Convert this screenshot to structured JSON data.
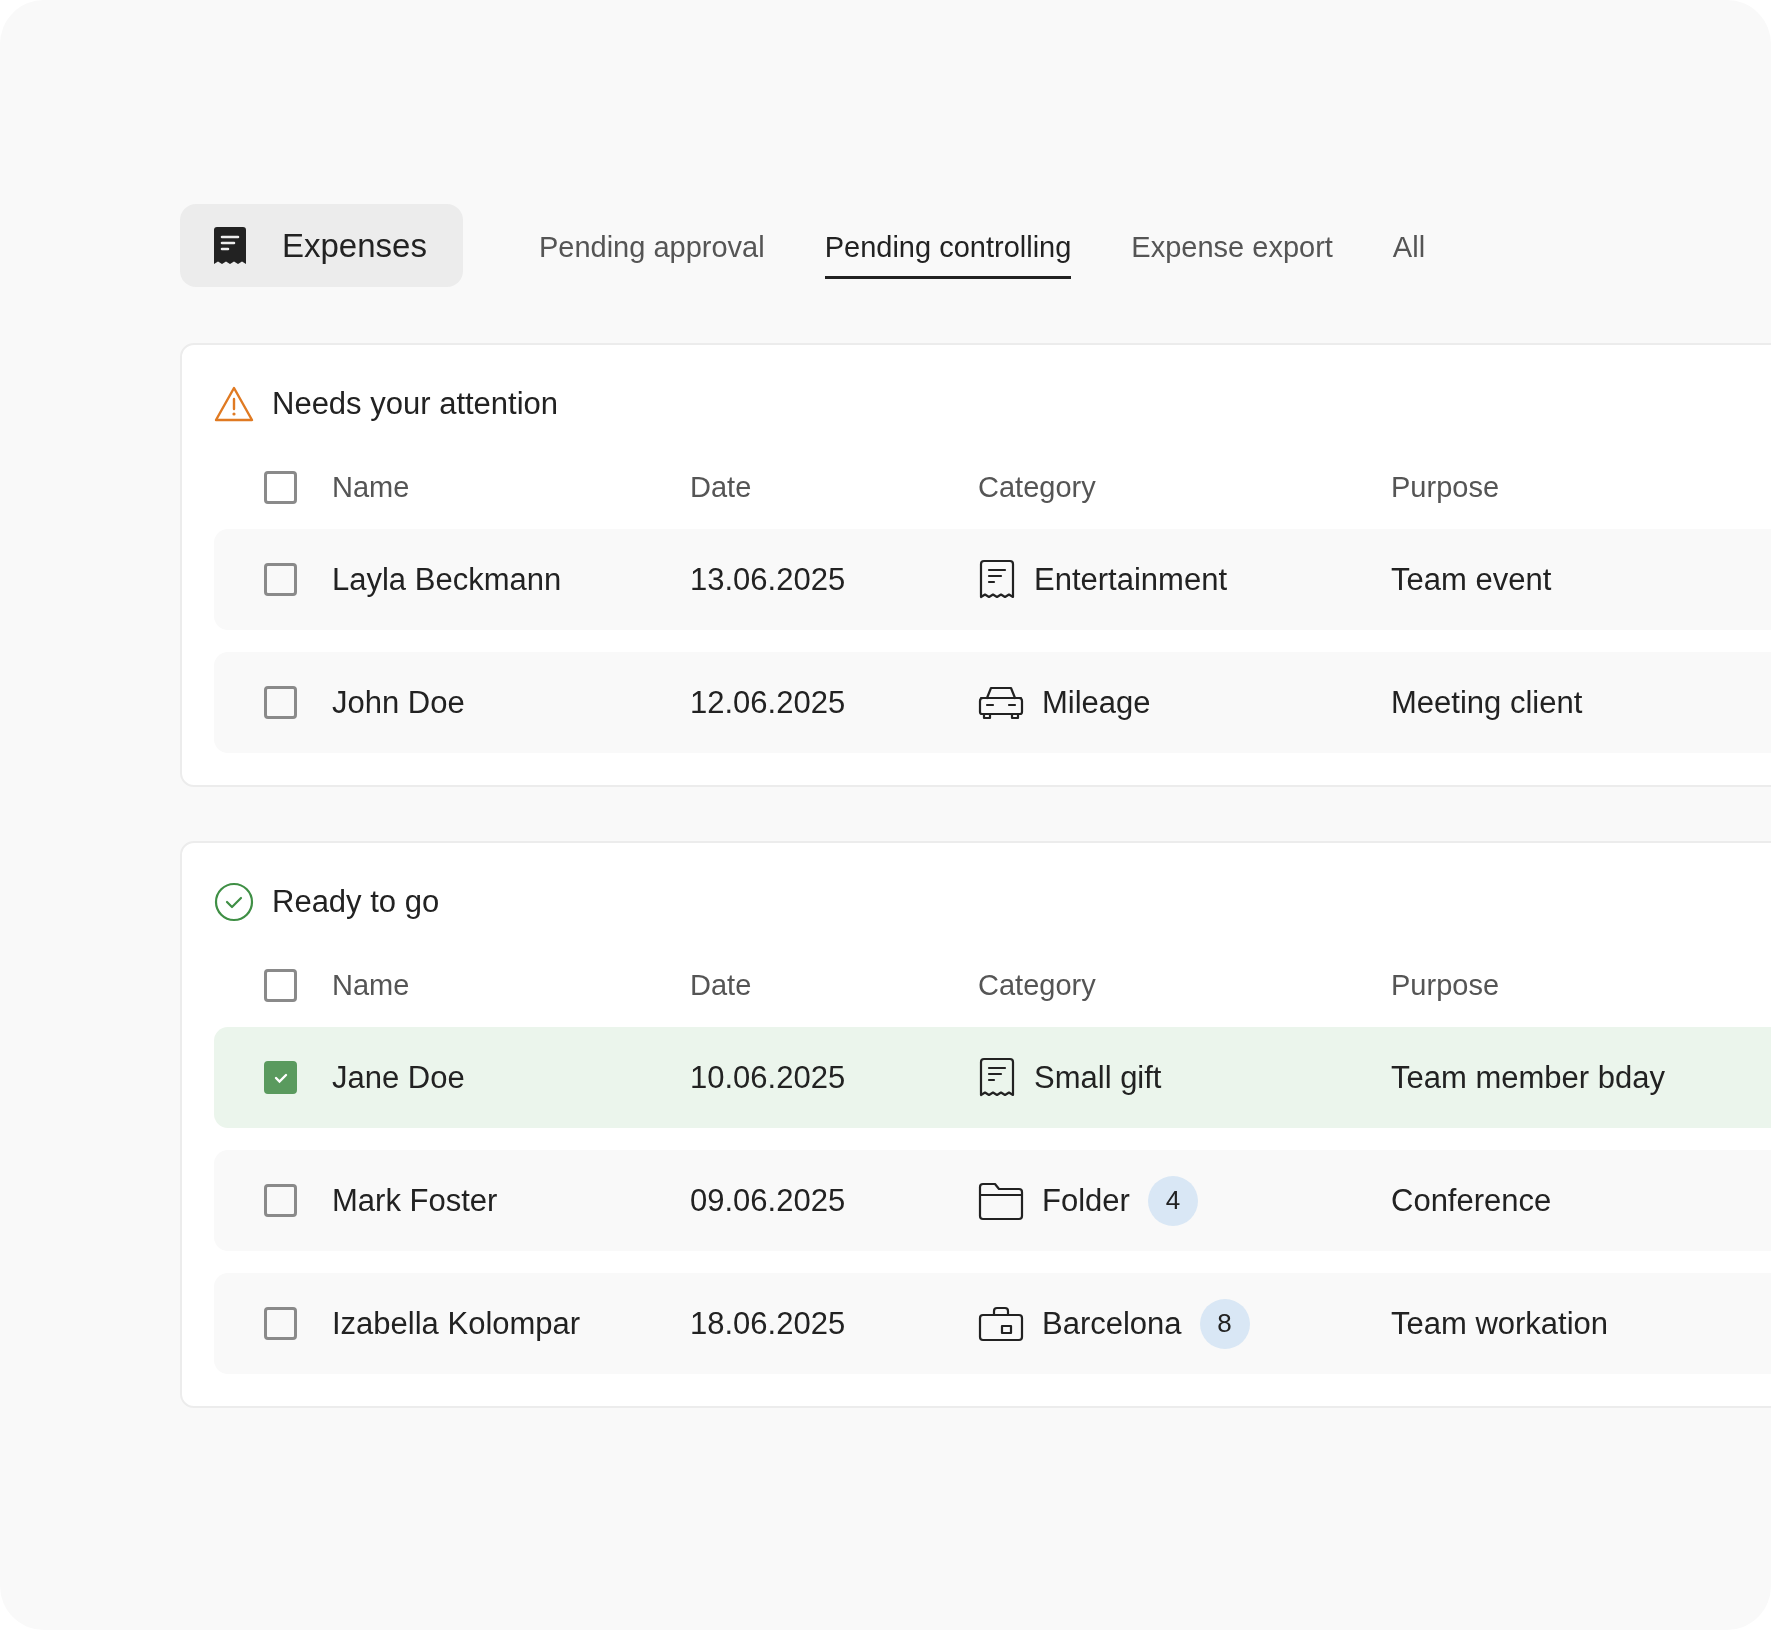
{
  "header": {
    "title": "Expenses"
  },
  "tabs": [
    {
      "label": "Pending approval",
      "selected": false
    },
    {
      "label": "Pending controlling",
      "selected": true
    },
    {
      "label": "Expense export",
      "selected": false
    },
    {
      "label": "All",
      "selected": false
    }
  ],
  "sections": [
    {
      "kind": "attention",
      "title": "Needs your attention",
      "select_all": {
        "checked": false
      },
      "columns": [
        "Name",
        "Date",
        "Category",
        "Purpose"
      ],
      "rows": [
        {
          "name": "Layla Beckmann",
          "date": "13.06.2025",
          "kind": "receipt",
          "category": "Entertainment",
          "purpose": "Team event",
          "checked": false,
          "selected": false
        },
        {
          "name": "John Doe",
          "date": "12.06.2025",
          "kind": "car",
          "category": "Mileage",
          "purpose": "Meeting client",
          "checked": false,
          "selected": false
        }
      ]
    },
    {
      "kind": "ready",
      "title": "Ready to go",
      "select_all": {
        "checked": false
      },
      "columns": [
        "Name",
        "Date",
        "Category",
        "Purpose"
      ],
      "rows": [
        {
          "name": "Jane Doe",
          "date": "10.06.2025",
          "kind": "receipt",
          "category": "Small gift",
          "purpose": "Team member bday",
          "checked": true,
          "selected": true
        },
        {
          "name": "Mark Foster",
          "date": "09.06.2025",
          "kind": "folder",
          "category": "Folder",
          "count": "4",
          "purpose": "Conference",
          "checked": false,
          "selected": false
        },
        {
          "name": "Izabella Kolompar",
          "date": "18.06.2025",
          "kind": "briefcase",
          "category": "Barcelona",
          "count": "8",
          "purpose": "Team workation",
          "checked": false,
          "selected": false
        }
      ]
    }
  ]
}
